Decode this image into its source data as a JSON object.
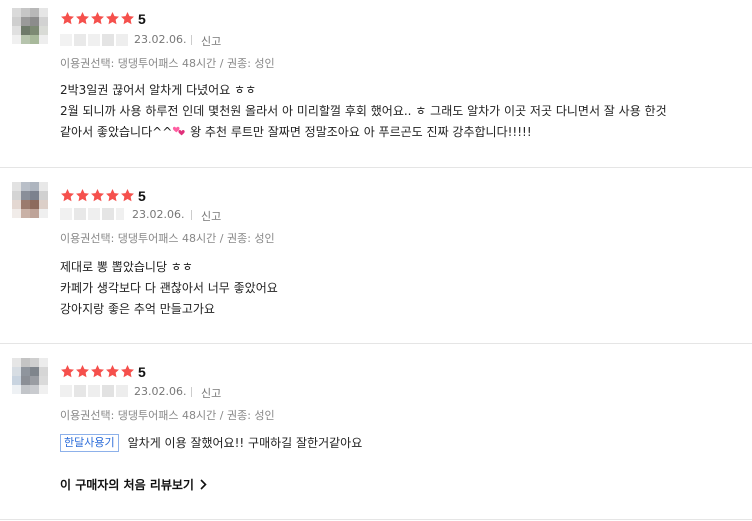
{
  "colors": {
    "star": "#f5504c",
    "accent_tag": "#2b6cd9",
    "divider": "#e5e5e5",
    "muted_text": "#888888"
  },
  "reviews": [
    {
      "rating": "5",
      "star_count": 5,
      "date": "23.02.06.",
      "report_label": "신고",
      "option": "이용권선택: 댕댕투어패스 48시간 / 권종: 성인",
      "lines": [
        "2박3일권 끊어서 알차게 다녔어요 ㅎㅎ",
        "2월 되니까 사용 하루전 인데 몇천원 올라서 아 미리할껄 후회 했어요.. ㅎ 그래도 알차가 이곳 저곳 다니면서 잘 사용 한것",
        "같아서 좋았습니다^^",
        " 왕 추천 루트만 잘짜면 정말조아요 아 푸르곤도 진짜 강추합니다!!!!!"
      ],
      "heart_icon": "two-hearts-icon"
    },
    {
      "rating": "5",
      "star_count": 5,
      "date": "23.02.06.",
      "report_label": "신고",
      "option": "이용권선택: 댕댕투어패스 48시간 / 권종: 성인",
      "lines": [
        "제대로 뽕 뽑았습니당 ㅎㅎ",
        "카페가 생각보다 다 괜찮아서 너무 좋았어요",
        "강아지랑 좋은 추억 만들고가요"
      ]
    },
    {
      "rating": "5",
      "star_count": 5,
      "date": "23.02.06.",
      "report_label": "신고",
      "option": "이용권선택: 댕댕투어패스 48시간 / 권종: 성인",
      "tag": "한달사용기",
      "text": "알차게 이용 잘했어요!! 구매하길 잘한거같아요",
      "first_review_link": "이 구매자의 처음 리뷰보기",
      "chevron_icon": "chevron-right-icon"
    }
  ]
}
